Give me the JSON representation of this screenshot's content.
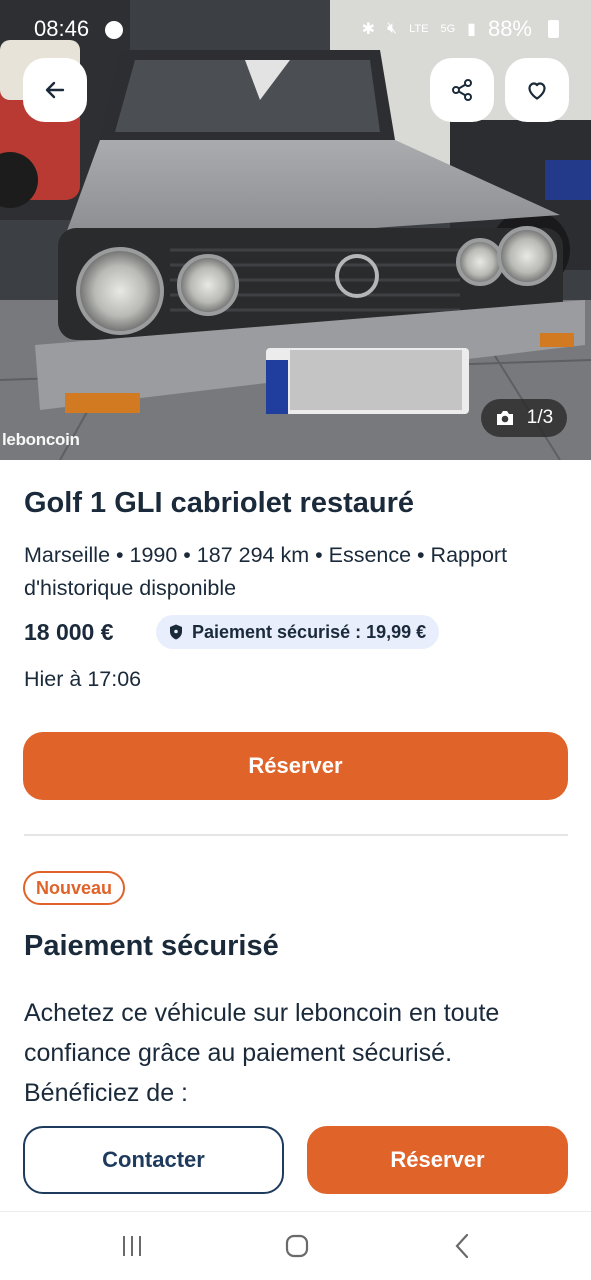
{
  "status_bar": {
    "time": "08:46",
    "battery": "88%",
    "network": "LTE",
    "signal_5g": "5G"
  },
  "gallery": {
    "counter": "1/3",
    "watermark": "leboncoin"
  },
  "ad": {
    "title": "Golf 1 GLI cabriolet restauré",
    "meta": "Marseille • 1990 • 187 294 km • Essence • Rapport d'historique disponible",
    "price": "18 000 €",
    "secure_badge": "Paiement sécurisé : 19,99 €",
    "date": "Hier à 17:06",
    "reserve_label": "Réserver"
  },
  "secure_section": {
    "badge": "Nouveau",
    "title": "Paiement sécurisé",
    "body": "Achetez ce véhicule sur leboncoin en toute confiance grâce au paiement sécurisé. Bénéficiez de :"
  },
  "footer": {
    "contact_label": "Contacter",
    "reserve_label": "Réserver"
  },
  "colors": {
    "accent_orange": "#e0632a",
    "navy": "#1e3a5c",
    "badge_blue_bg": "#e8eefc"
  },
  "icons": {
    "back": "arrow-left-icon",
    "share": "share-icon",
    "favorite": "heart-icon",
    "camera": "camera-icon",
    "shield": "shield-icon"
  }
}
